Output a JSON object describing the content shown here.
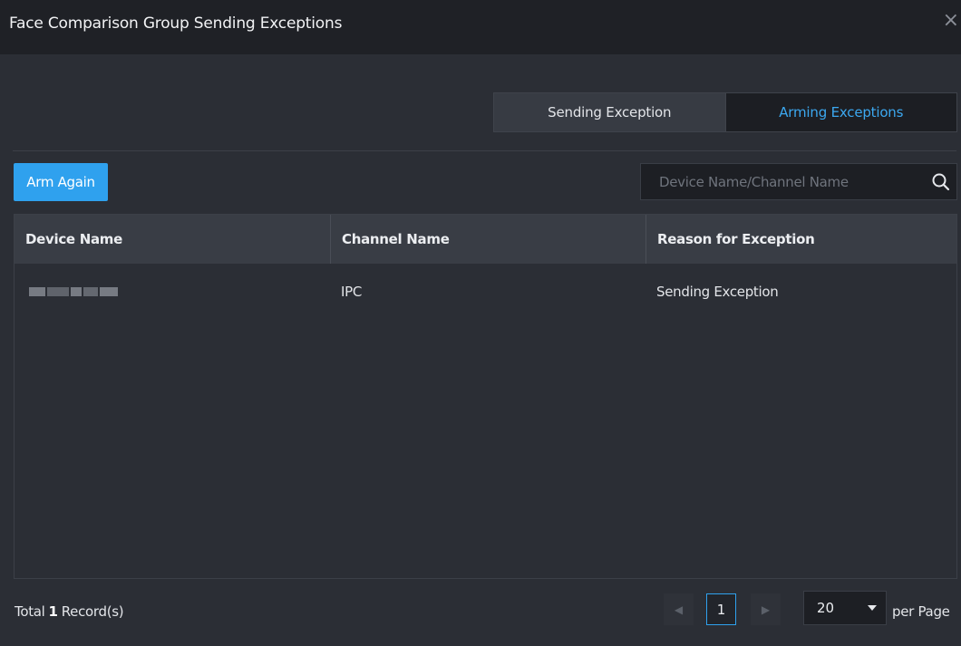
{
  "dialog": {
    "title": "Face Comparison Group Sending Exceptions",
    "close_glyph": "×"
  },
  "tabs": [
    {
      "label": "Sending Exception",
      "active": false
    },
    {
      "label": "Arming Exceptions",
      "active": true
    }
  ],
  "toolbar": {
    "arm_again_label": "Arm Again",
    "search_placeholder": "Device Name/Channel Name",
    "search_value": ""
  },
  "table": {
    "columns": [
      "Device Name",
      "Channel Name",
      "Reason for Exception"
    ],
    "rows": [
      {
        "device_name": "",
        "channel_name": "IPC",
        "reason": "Sending Exception"
      }
    ]
  },
  "footer": {
    "total_prefix": "Total",
    "total_count": "1",
    "total_suffix": "Record(s)",
    "current_page": "1",
    "page_size": "20",
    "per_page_label": "per Page",
    "prev_glyph": "◀",
    "next_glyph": "▶"
  },
  "colors": {
    "accent": "#2fa1ee",
    "active_tab_text": "#3ca8f0",
    "background": "#2b2e35",
    "titlebar": "#1f2126"
  },
  "icons": [
    "close-icon",
    "search-icon",
    "prev-page-icon",
    "next-page-icon",
    "dropdown-caret-icon"
  ]
}
